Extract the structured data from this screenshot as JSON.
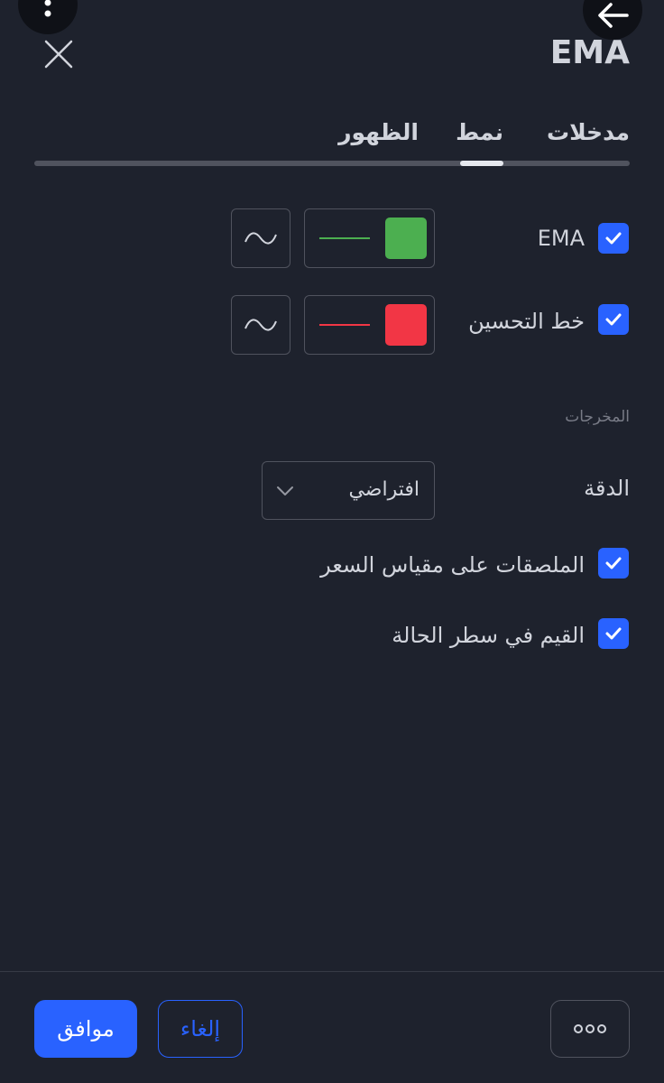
{
  "dialog": {
    "title": "EMA"
  },
  "tabs": [
    {
      "label": "مدخلات"
    },
    {
      "label": "نمط",
      "active": true
    },
    {
      "label": "الظهور"
    }
  ],
  "styles": [
    {
      "label": "EMA",
      "checked": true,
      "color": "#4caf50",
      "line": "line-icon"
    },
    {
      "label": "خط التحسين",
      "checked": true,
      "color": "#f23645",
      "line": "line-icon"
    }
  ],
  "outputs": {
    "section_title": "المخرجات",
    "precision_label": "الدقة",
    "precision_value": "افتراضي",
    "labels_on_price_scale": "الملصقات على مقياس السعر",
    "values_in_status_line": "القيم في سطر الحالة"
  },
  "footer": {
    "ok_label": "موافق",
    "cancel_label": "إلغاء"
  },
  "colors": {
    "accent": "#2962ff",
    "background": "#1e222d"
  }
}
